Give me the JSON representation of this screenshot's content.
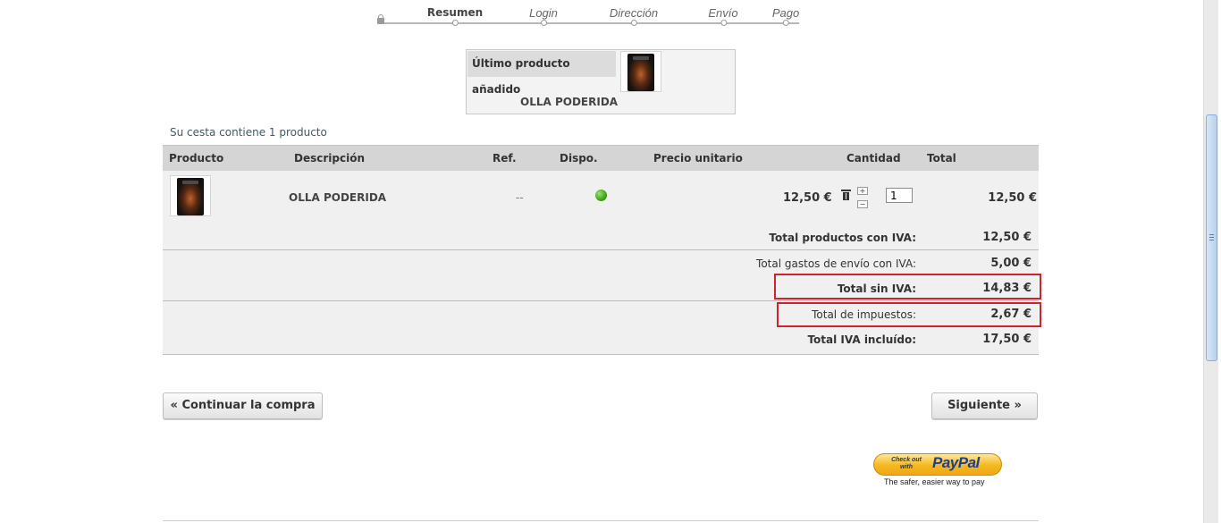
{
  "steps": [
    {
      "label": "Resumen",
      "state": "active"
    },
    {
      "label": "Login",
      "state": "pending"
    },
    {
      "label": "Dirección",
      "state": "pending"
    },
    {
      "label": "Envío",
      "state": "pending"
    },
    {
      "label": "Pago",
      "state": "pending"
    }
  ],
  "last_added": {
    "heading": "Último producto añadido",
    "name": "OLLA PODERIDA"
  },
  "cart": {
    "count_text": "Su cesta contiene 1 producto",
    "headers": {
      "producto": "Producto",
      "descripcion": "Descripción",
      "ref": "Ref.",
      "dispo": "Dispo.",
      "precio": "Precio unitario",
      "cantidad": "Cantidad",
      "total": "Total"
    },
    "row": {
      "description": "OLLA PODERIDA",
      "ref": "--",
      "unit_price": "12,50 €",
      "quantity": "1",
      "total": "12,50 €",
      "qty_up": "+",
      "qty_down": "−"
    },
    "summary": {
      "products_label": "Total productos con IVA:",
      "products_value": "12,50 €",
      "shipping_label": "Total gastos de envío con IVA:",
      "shipping_value": "5,00 €",
      "no_vat_label": "Total sin IVA:",
      "no_vat_value": "14,83 €",
      "taxes_label": "Total de impuestos:",
      "taxes_value": "2,67 €",
      "grand_label": "Total IVA incluído:",
      "grand_value": "17,50 €"
    }
  },
  "buttons": {
    "continue": "« Continuar la compra",
    "next": "Siguiente »"
  },
  "paypal": {
    "check_text": "Check out with",
    "logo": "PayPal",
    "tagline": "The safer, easier way to pay"
  },
  "colors": {
    "highlight": "#d3212d",
    "availability": "#3fa31c",
    "paypal_gold": "#f5b81f"
  }
}
